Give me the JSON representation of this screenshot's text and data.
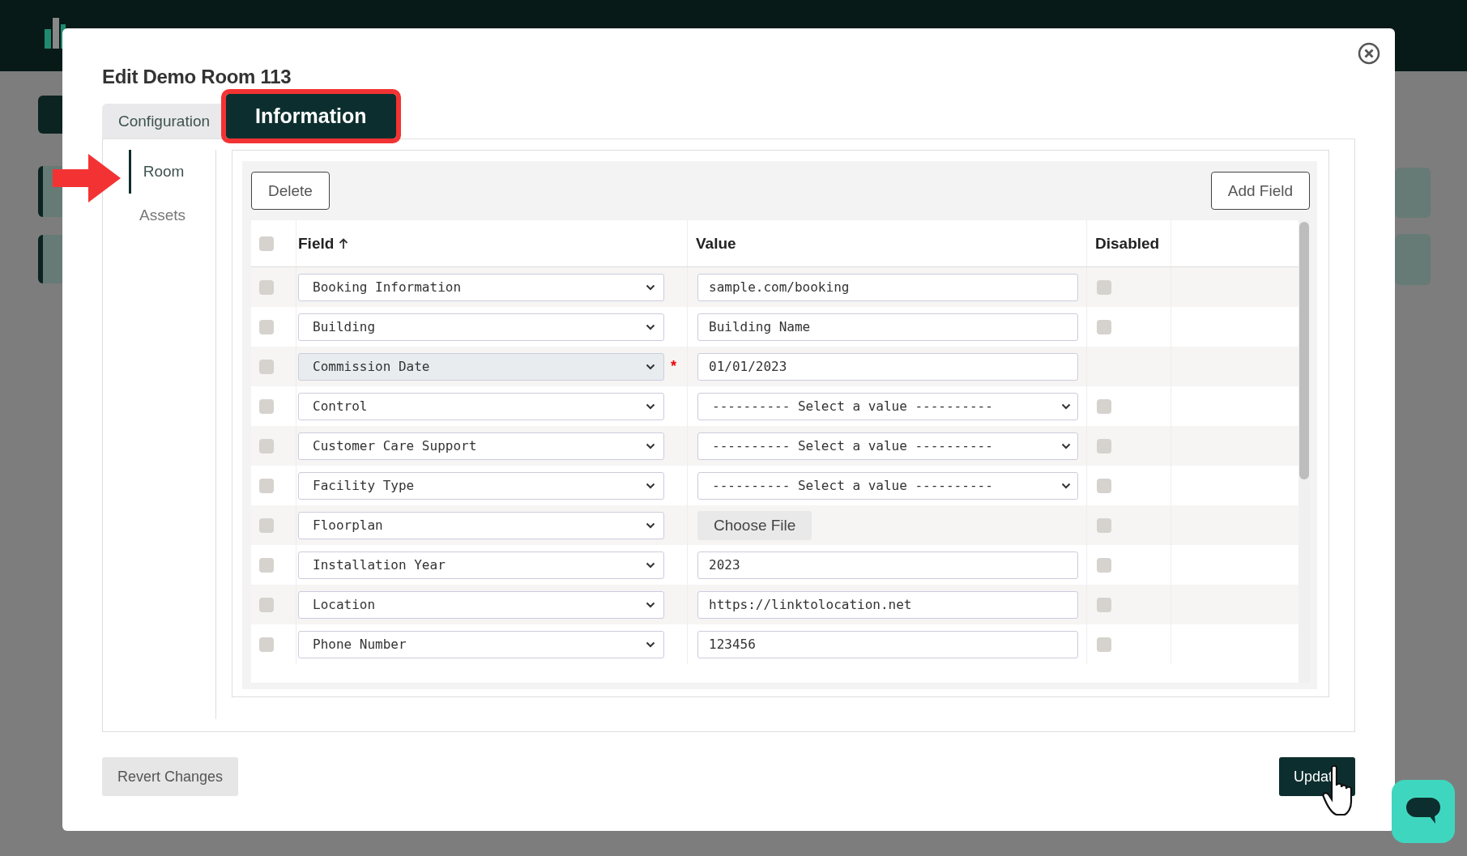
{
  "dialog": {
    "title": "Edit Demo Room 113"
  },
  "tabs": [
    {
      "label": "Configuration",
      "selected": false
    },
    {
      "label": "Information",
      "selected": true,
      "highlighted": true
    }
  ],
  "sidebar": {
    "items": [
      {
        "label": "Room",
        "selected": true
      },
      {
        "label": "Assets",
        "selected": false
      }
    ]
  },
  "toolbar": {
    "buttons": [
      "Delete",
      "Add Field"
    ]
  },
  "table": {
    "select_all_checked": false,
    "columns": [
      {
        "label": "Field",
        "sorted_ascending": true
      },
      {
        "label": "Value"
      },
      {
        "label": "Disabled"
      }
    ],
    "rows": [
      {
        "field": "Booking Information",
        "kind": "text",
        "value": "sample.com/booking",
        "checked": false,
        "focused": false,
        "has_disabled_toggle": true,
        "disabled": false
      },
      {
        "field": "Building",
        "kind": "text",
        "value": "Building Name",
        "checked": false,
        "focused": false,
        "has_disabled_toggle": true,
        "disabled": false
      },
      {
        "field": "Commission Date",
        "kind": "text",
        "value": "01/01/2023",
        "checked": false,
        "focused": true,
        "required_mark": "*",
        "has_disabled_toggle": false
      },
      {
        "field": "Control",
        "kind": "select",
        "value": "---------- Select a value ----------",
        "checked": false,
        "focused": false,
        "has_disabled_toggle": true,
        "disabled": false
      },
      {
        "field": "Customer Care Support",
        "kind": "select",
        "value": "---------- Select a value ----------",
        "checked": false,
        "focused": false,
        "has_disabled_toggle": true,
        "disabled": false
      },
      {
        "field": "Facility Type",
        "kind": "select",
        "value": "---------- Select a value ----------",
        "checked": false,
        "focused": false,
        "has_disabled_toggle": true,
        "disabled": false
      },
      {
        "field": "Floorplan",
        "kind": "file",
        "value": "Choose File",
        "checked": false,
        "focused": false,
        "has_disabled_toggle": true,
        "disabled": false
      },
      {
        "field": "Installation Year",
        "kind": "text",
        "value": "2023",
        "checked": false,
        "focused": false,
        "has_disabled_toggle": true,
        "disabled": false
      },
      {
        "field": "Location",
        "kind": "text",
        "value": "https://linktolocation.net",
        "checked": false,
        "focused": false,
        "has_disabled_toggle": true,
        "disabled": false
      },
      {
        "field": "Phone Number",
        "kind": "text",
        "value": "123456",
        "checked": false,
        "focused": false,
        "has_disabled_toggle": true,
        "disabled": false
      }
    ]
  },
  "footer": {
    "revert_button": "Revert Changes",
    "update_button": "Updat"
  }
}
